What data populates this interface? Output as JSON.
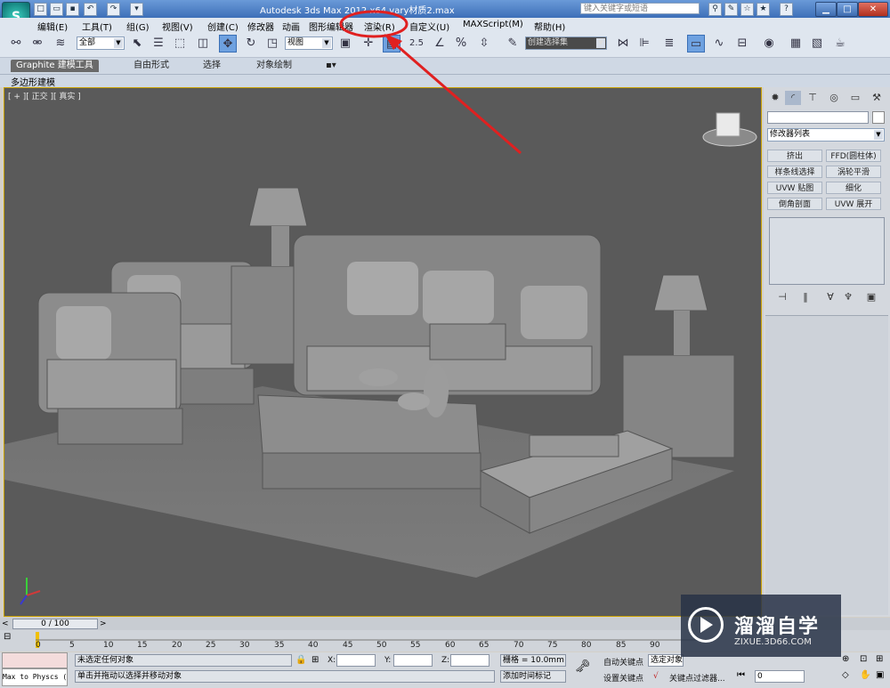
{
  "window": {
    "title": "Autodesk 3ds Max  2012 x64    vary材质2.max",
    "search_placeholder": "键入关键字或短语",
    "logo_letter": "S"
  },
  "menu": [
    "编辑(E)",
    "工具(T)",
    "组(G)",
    "视图(V)",
    "创建(C)",
    "修改器",
    "动画",
    "图形编辑器",
    "渲染(R)",
    "自定义(U)",
    "MAXScript(M)",
    "帮助(H)"
  ],
  "toolbar": {
    "selection_filter": "全部",
    "reference_coord": "视图",
    "named_selection": "创建选择集",
    "snap_label": "2.5",
    "percent_label": "%"
  },
  "ribbon": {
    "tabs": [
      "Graphite 建模工具",
      "自由形式",
      "选择",
      "对象绘制"
    ],
    "sub_label": "多边形建模"
  },
  "viewport": {
    "label": "[ + ][ 正交 ][ 真实 ]"
  },
  "command_panel": {
    "modifier_list": "修改器列表",
    "modifiers": [
      "挤出",
      "FFD(圆柱体)",
      "样条线选择",
      "涡轮平滑",
      "UVW 贴图",
      "细化",
      "倒角剖面",
      "UVW 展开"
    ]
  },
  "timeline": {
    "frame": "0 / 100",
    "ticks": [
      "0",
      "5",
      "10",
      "15",
      "20",
      "25",
      "30",
      "35",
      "40",
      "45",
      "50",
      "55",
      "60",
      "65",
      "70",
      "75",
      "80",
      "85",
      "90"
    ]
  },
  "status": {
    "script_label": "Max to Physcs (",
    "selection_status": "未选定任何对象",
    "prompt": "单击并拖动以选择并移动对象",
    "x_label": "X:",
    "y_label": "Y:",
    "z_label": "Z:",
    "grid": "栅格 = 10.0mm",
    "add_time_tag": "添加时间标记",
    "auto_key": "自动关键点",
    "set_key": "设置关键点",
    "selected_object": "选定对象",
    "key_filters": "关键点过滤器...",
    "frame_value": "0"
  },
  "watermark": {
    "title": "溜溜自学",
    "url": "ZIXUE.3D66.COM"
  },
  "annotation": {
    "color": "#e02020"
  }
}
